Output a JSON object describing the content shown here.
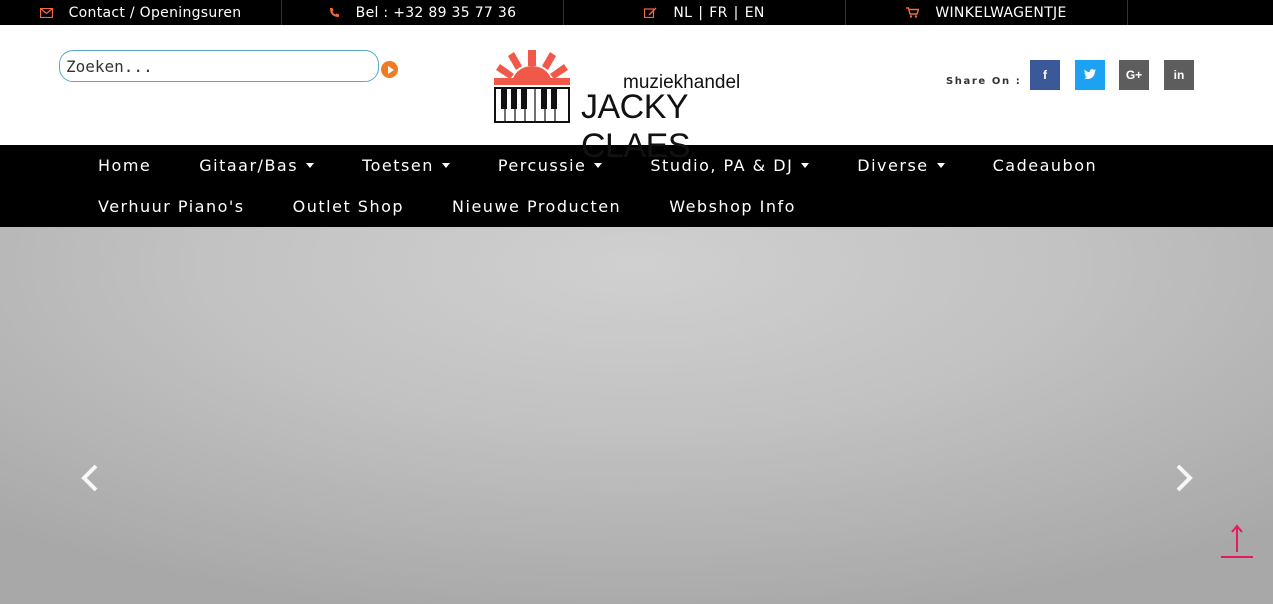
{
  "topbar": {
    "contact": "Contact / Openingsuren",
    "phone": "Bel : +32 89 35 77 36",
    "lang_nl": "NL",
    "lang_fr": "FR",
    "lang_en": "EN",
    "lang_sep": "|",
    "cart": "WINKELWAGENTJE",
    "accent_color": "#f26a3d"
  },
  "search": {
    "placeholder": "Zoeken..."
  },
  "logo": {
    "subtitle": "muziekhandel",
    "name": "JACKY CLAES"
  },
  "share": {
    "label": "Share On :",
    "facebook": "f",
    "twitter": "t",
    "googleplus": "G+",
    "linkedin": "in"
  },
  "nav": {
    "row1": [
      {
        "label": "Home"
      },
      {
        "label": "Gitaar/Bas"
      },
      {
        "label": "Toetsen"
      },
      {
        "label": "Percussie"
      },
      {
        "label": "Studio, PA & DJ"
      },
      {
        "label": "Diverse"
      },
      {
        "label": "Cadeaubon"
      }
    ],
    "row2": [
      {
        "label": "Verhuur Piano's"
      },
      {
        "label": "Outlet Shop"
      },
      {
        "label": "Nieuwe Producten"
      },
      {
        "label": "Webshop Info"
      }
    ]
  }
}
